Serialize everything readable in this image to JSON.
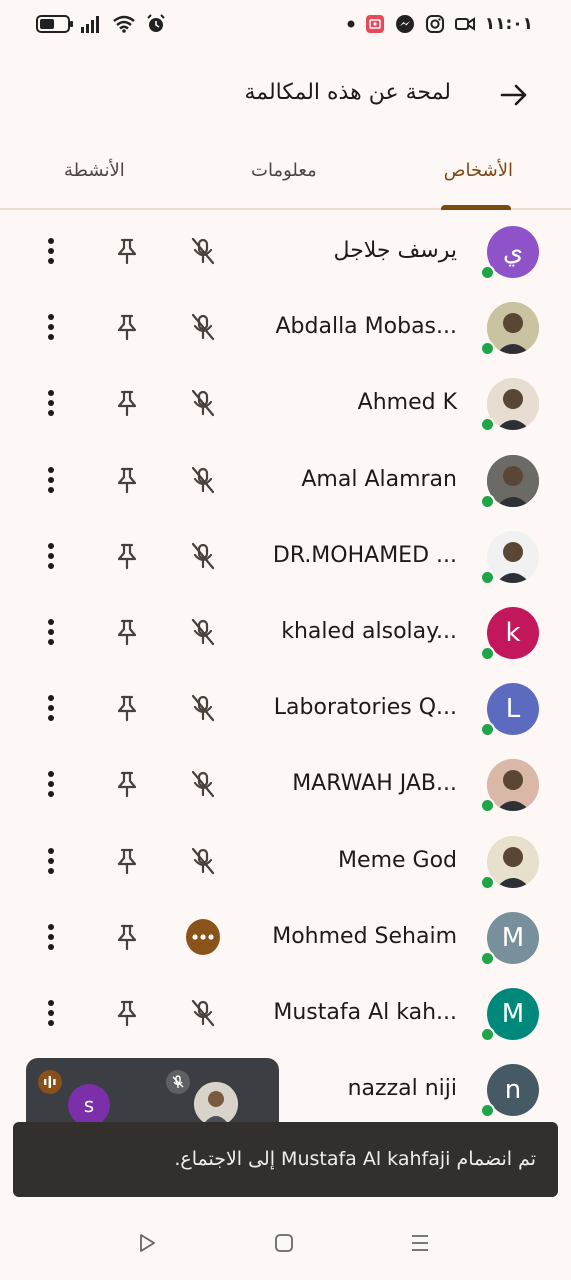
{
  "status_bar": {
    "time": "١١:٠١",
    "icons": [
      "battery-icon",
      "signal-icon",
      "wifi-icon",
      "alarm-icon",
      "dot-icon",
      "screen-recorder-icon",
      "messenger-icon",
      "instagram-icon",
      "video-icon"
    ]
  },
  "header": {
    "title": "لمحة عن هذه المكالمة",
    "back_icon": "arrow-right-icon"
  },
  "tabs": [
    {
      "label": "الأشخاص",
      "active": true
    },
    {
      "label": "معلومات",
      "active": false
    },
    {
      "label": "الأنشطة",
      "active": false
    }
  ],
  "participants": [
    {
      "name": "يرسف جلاجل",
      "initial": "ي",
      "avatar_color": "#8e52c9",
      "photo": false,
      "mic": "muted"
    },
    {
      "name": "Abdalla Mobas...",
      "initial": "",
      "avatar_color": "#c9c3a2",
      "photo": true,
      "mic": "muted"
    },
    {
      "name": "Ahmed K",
      "initial": "",
      "avatar_color": "#e7ddd0",
      "photo": true,
      "mic": "muted"
    },
    {
      "name": "Amal Alamran",
      "initial": "",
      "avatar_color": "#6c6a64",
      "photo": true,
      "mic": "muted"
    },
    {
      "name": "DR.MOHAMED ...",
      "initial": "",
      "avatar_color": "#f1f1f1",
      "photo": true,
      "mic": "muted"
    },
    {
      "name": "khaled alsolay...",
      "initial": "k",
      "avatar_color": "#c2185b",
      "photo": false,
      "mic": "muted"
    },
    {
      "name": "Laboratories Q...",
      "initial": "L",
      "avatar_color": "#5c6bc0",
      "photo": false,
      "mic": "muted"
    },
    {
      "name": "MARWAH JAB...",
      "initial": "",
      "avatar_color": "#d9b8a8",
      "photo": true,
      "mic": "muted"
    },
    {
      "name": "Meme God",
      "initial": "",
      "avatar_color": "#e6e0cc",
      "photo": true,
      "mic": "muted"
    },
    {
      "name": "Mohmed Sehaim",
      "initial": "M",
      "avatar_color": "#78909c",
      "photo": false,
      "mic": "speaking"
    },
    {
      "name": "Mustafa Al kah...",
      "initial": "M",
      "avatar_color": "#00897b",
      "photo": false,
      "mic": "muted"
    },
    {
      "name": "nazzal niji",
      "initial": "n",
      "avatar_color": "#455a64",
      "photo": false,
      "mic": "hidden"
    }
  ],
  "pip": {
    "initial": "s"
  },
  "snackbar": {
    "text": "تم انضمام Mustafa Al kahfaji إلى الاجتماع."
  },
  "navbar": {
    "icons": [
      "back-triangle-icon",
      "home-square-icon",
      "recents-menu-icon"
    ]
  }
}
